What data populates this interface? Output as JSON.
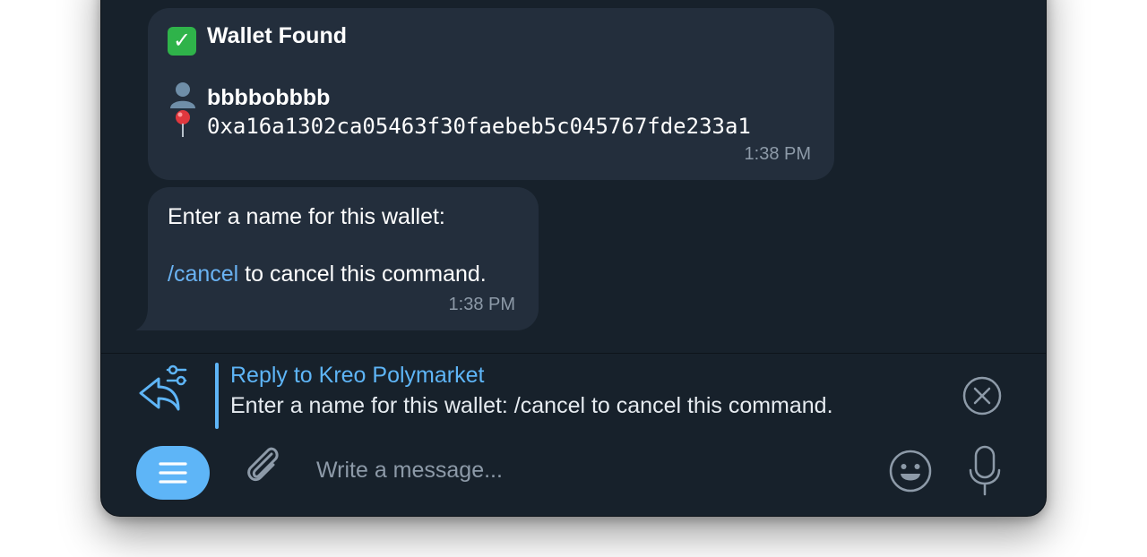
{
  "messages": [
    {
      "title": "Wallet Found",
      "title_icon": "check-mark-emoji",
      "name_icon": "person-silhouette-emoji",
      "name": "bbbbobbbb",
      "address_icon": "round-pushpin-emoji",
      "address": "0xa16a1302ca05463f30faebeb5c045767fde233a1",
      "time": "1:38 PM"
    },
    {
      "line1": "Enter a name for this wallet:",
      "command": "/cancel",
      "line2_rest": " to cancel this command.",
      "time": "1:38 PM"
    }
  ],
  "reply": {
    "title": "Reply to Kreo Polymarket",
    "text": "Enter a name for this wallet:  /cancel to cancel this command."
  },
  "composer": {
    "placeholder": "Write a message..."
  },
  "colors": {
    "background": "#17212b",
    "bubble": "#232e3c",
    "accent": "#5eb5f7",
    "link": "#6ab3f3",
    "muted": "#8d9aa8"
  }
}
